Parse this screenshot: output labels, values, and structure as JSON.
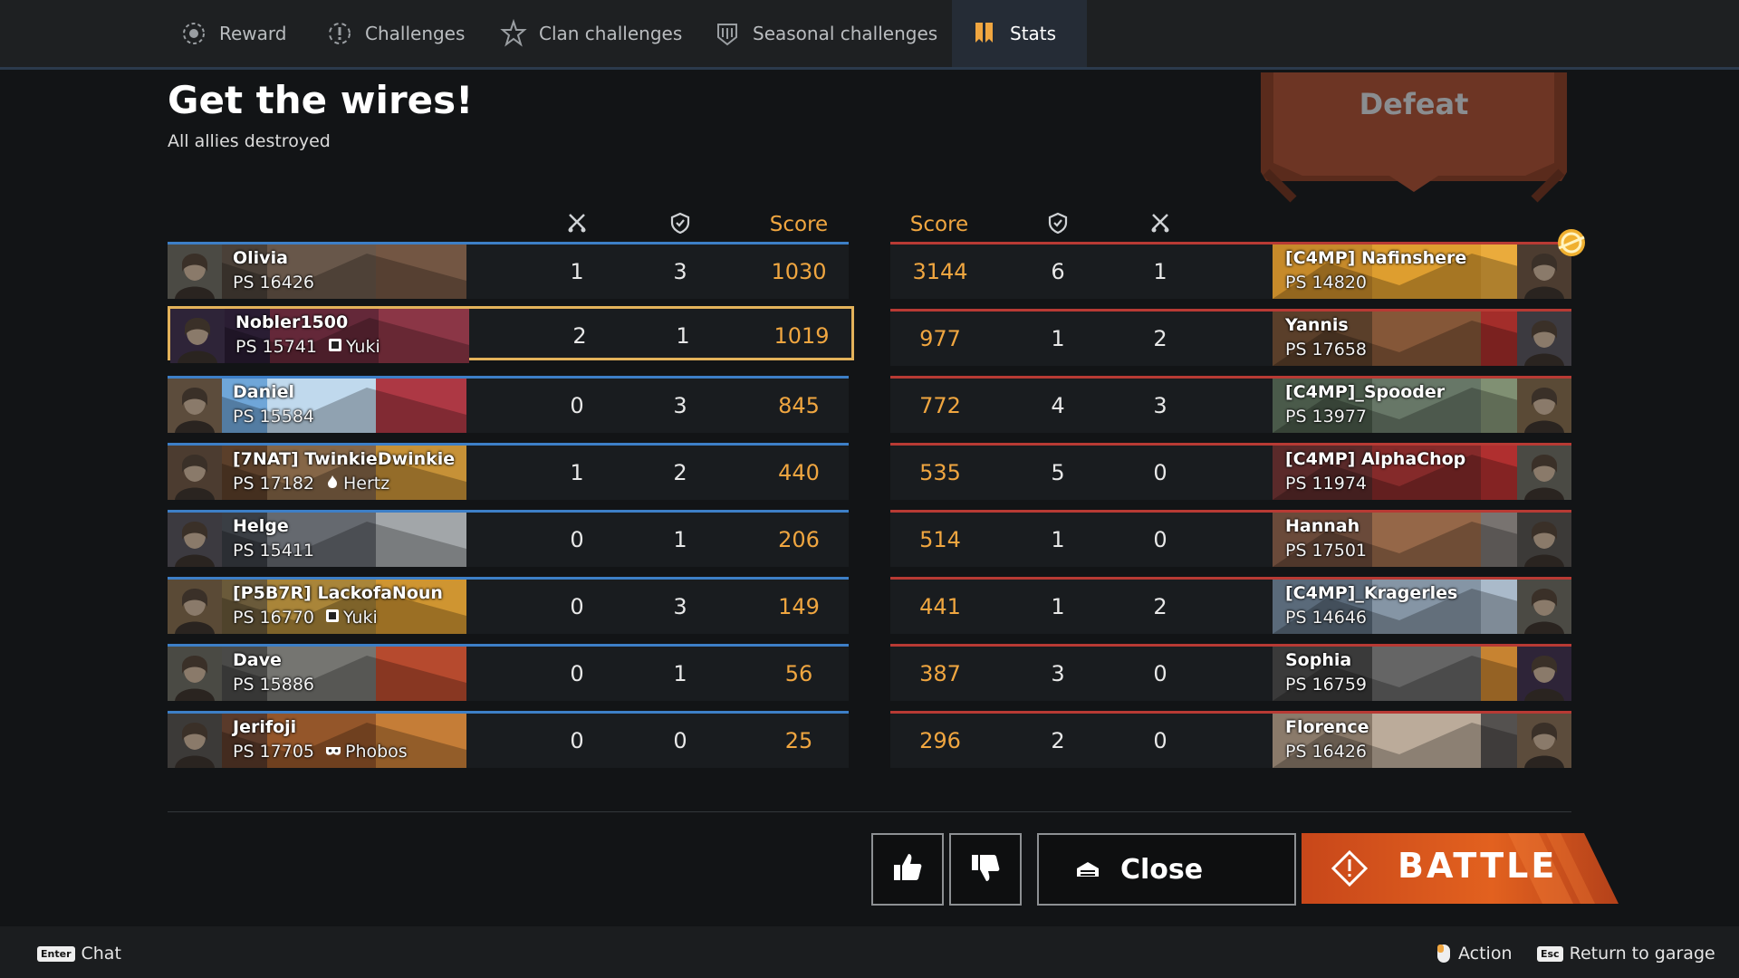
{
  "tabs": [
    {
      "label": "Reward",
      "icon": "reward-icon"
    },
    {
      "label": "Challenges",
      "icon": "challenges-icon"
    },
    {
      "label": "Clan challenges",
      "icon": "clan-challenges-icon"
    },
    {
      "label": "Seasonal challenges",
      "icon": "seasonal-challenges-icon"
    },
    {
      "label": "Stats",
      "icon": "stats-icon",
      "active": true
    }
  ],
  "header": {
    "title": "Get the wires!",
    "subtitle": "All allies destroyed",
    "result": "Defeat"
  },
  "columns": {
    "kills_icon": "crossed-swords-icon",
    "assists_icon": "shield-icon",
    "score_label": "Score"
  },
  "allies": [
    {
      "name": "Olivia",
      "ps": "PS 16426",
      "kills": "1",
      "assists": "3",
      "score": "1030"
    },
    {
      "name": "Nobler1500",
      "ps": "PS 15741",
      "clan_icon": "square-emblem-icon",
      "clan": "Yuki",
      "kills": "2",
      "assists": "1",
      "score": "1019",
      "highlight": true
    },
    {
      "name": "Daniel",
      "ps": "PS 15584",
      "kills": "0",
      "assists": "3",
      "score": "845"
    },
    {
      "name": "[7NAT] TwinkieDwinkie",
      "ps": "PS 17182",
      "clan_icon": "fire-emblem-icon",
      "clan": "Hertz",
      "kills": "1",
      "assists": "2",
      "score": "440"
    },
    {
      "name": "Helge",
      "ps": "PS 15411",
      "kills": "0",
      "assists": "1",
      "score": "206"
    },
    {
      "name": "[P5B7R] LackofaNoun",
      "ps": "PS 16770",
      "clan_icon": "square-emblem-icon",
      "clan": "Yuki",
      "kills": "0",
      "assists": "3",
      "score": "149"
    },
    {
      "name": "Dave",
      "ps": "PS 15886",
      "kills": "0",
      "assists": "1",
      "score": "56"
    },
    {
      "name": "Jerifoji",
      "ps": "PS 17705",
      "clan_icon": "mask-emblem-icon",
      "clan": "Phobos",
      "kills": "0",
      "assists": "0",
      "score": "25"
    }
  ],
  "enemies": [
    {
      "name": "[C4MP] Nafinshere",
      "ps": "PS 14820",
      "score": "3144",
      "assists": "6",
      "kills": "1",
      "badge": "mvp-badge-icon"
    },
    {
      "name": "Yannis",
      "ps": "PS 17658",
      "score": "977",
      "assists": "1",
      "kills": "2"
    },
    {
      "name": "[C4MP]_Spooder",
      "ps": "PS 13977",
      "score": "772",
      "assists": "4",
      "kills": "3"
    },
    {
      "name": "[C4MP] AlphaChop",
      "ps": "PS 11974",
      "score": "535",
      "assists": "5",
      "kills": "0"
    },
    {
      "name": "Hannah",
      "ps": "PS 17501",
      "score": "514",
      "assists": "1",
      "kills": "0"
    },
    {
      "name": "[C4MP]_Kragerles",
      "ps": "PS 14646",
      "score": "441",
      "assists": "1",
      "kills": "2"
    },
    {
      "name": "Sophia",
      "ps": "PS 16759",
      "score": "387",
      "assists": "3",
      "kills": "0"
    },
    {
      "name": "Florence",
      "ps": "PS 16426",
      "score": "296",
      "assists": "2",
      "kills": "0"
    }
  ],
  "buttons": {
    "like_icon": "thumbs-up-icon",
    "dislike_icon": "thumbs-down-icon",
    "close_label": "Close",
    "close_icon": "garage-icon",
    "battle_label": "BATTLE",
    "battle_icon": "battle-diamond-icon"
  },
  "footer": {
    "chat_key": "Enter",
    "chat_label": "Chat",
    "action_label": "Action",
    "return_key": "Esc",
    "return_label": "Return to garage"
  },
  "colors": {
    "accent_orange": "#f0a640",
    "ally_blue": "#3d7fc7",
    "enemy_red": "#b83a34",
    "battle_orange": "#d4541c"
  }
}
